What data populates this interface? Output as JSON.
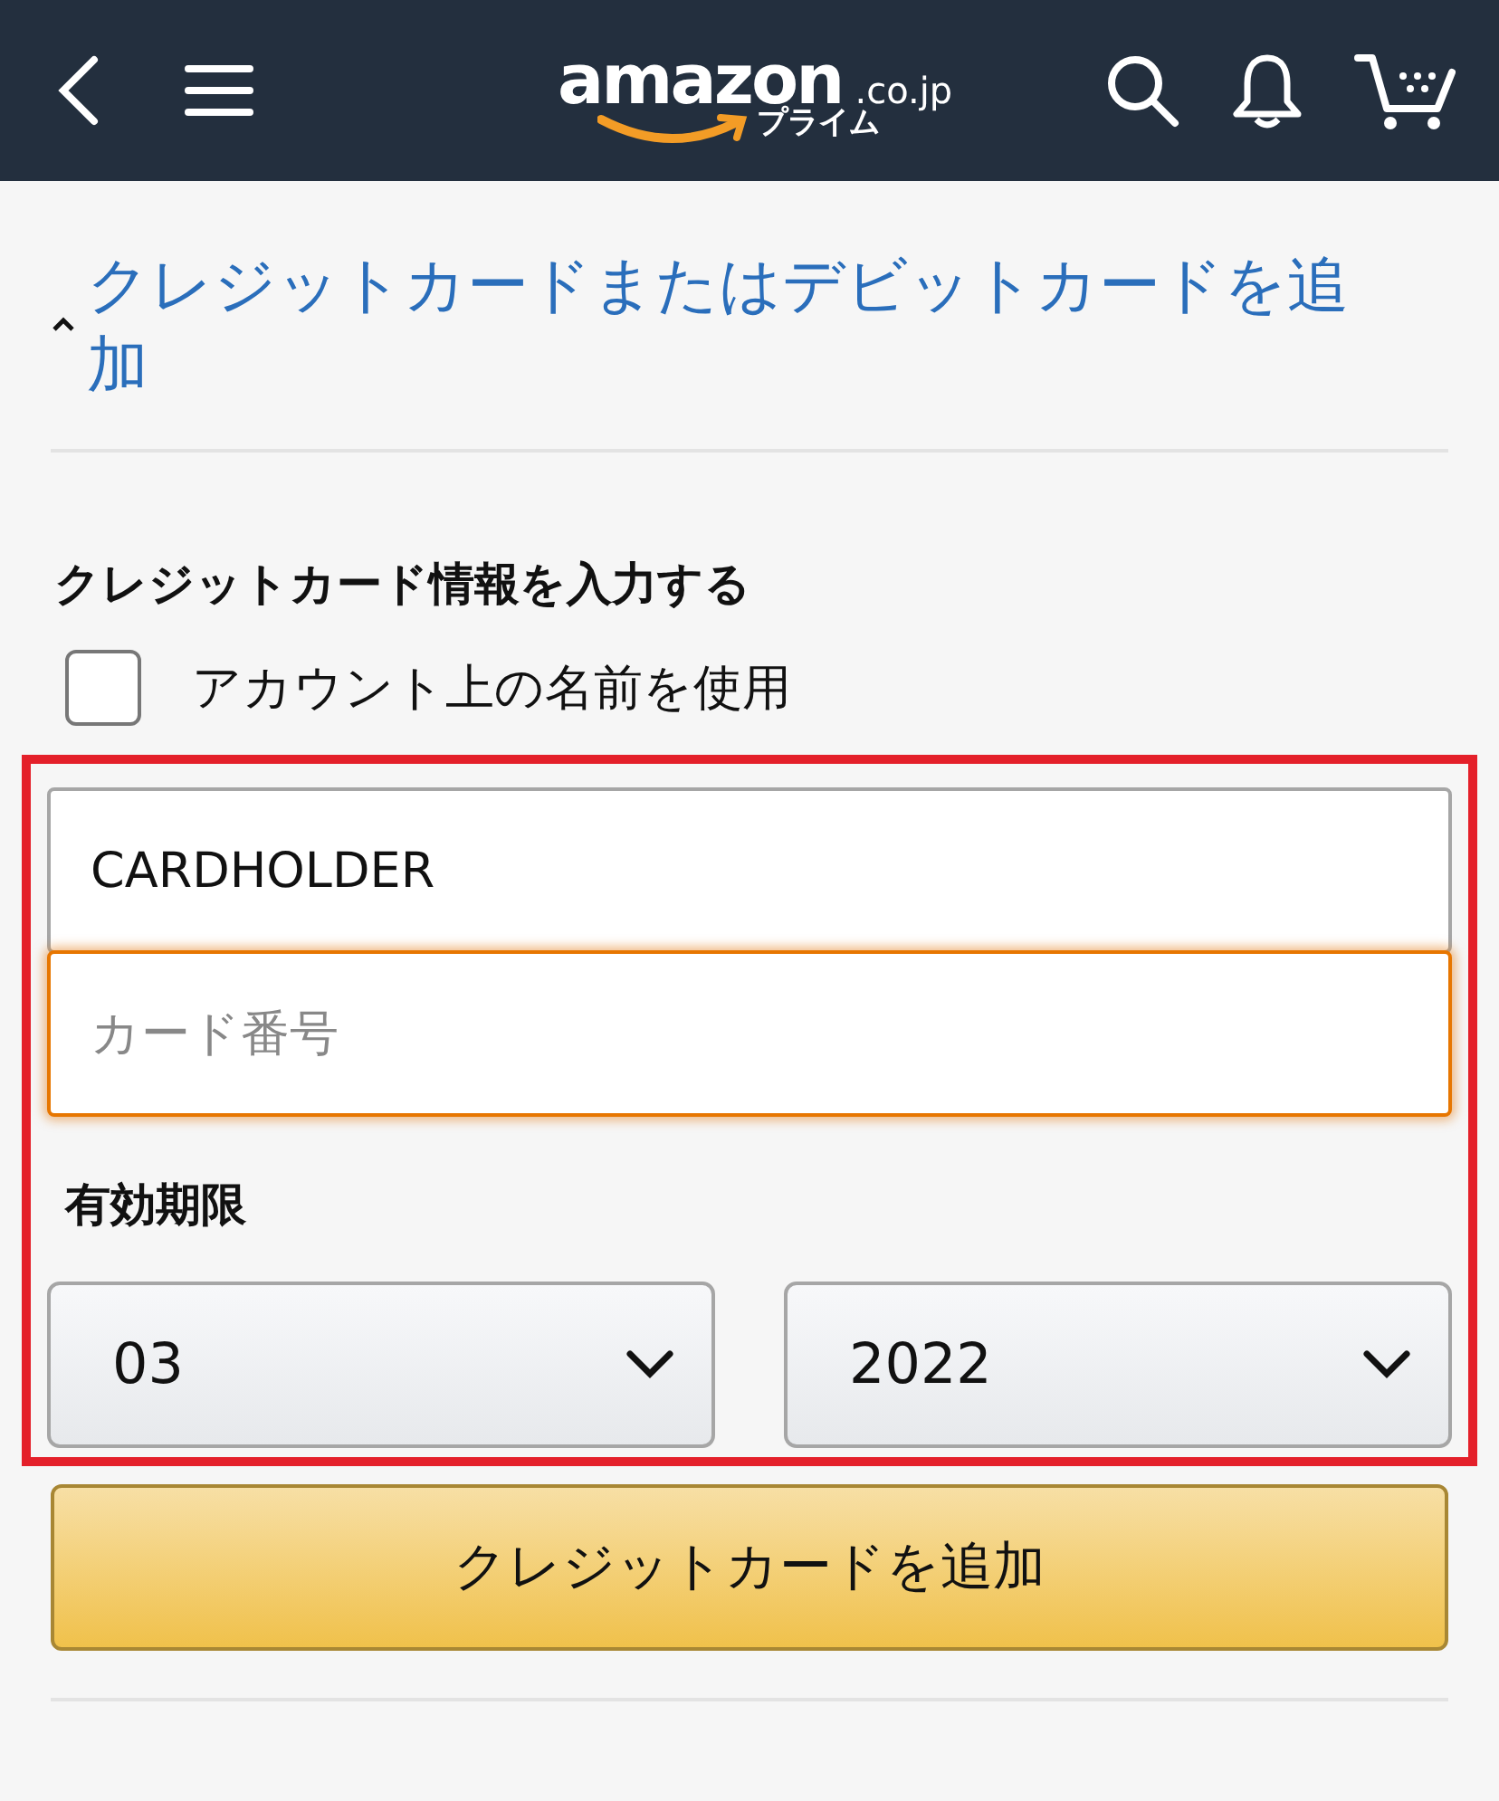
{
  "header": {
    "logo": {
      "wordmark": "amazon",
      "domain": ".co.jp",
      "tagline": "プライム"
    }
  },
  "section": {
    "title": "クレジットカードまたはデビットカードを追加",
    "expanded": true
  },
  "form": {
    "heading": "クレジットカード情報を入力する",
    "use_account_name": {
      "label": "アカウント上の名前を使用",
      "checked": false
    },
    "highlighted": true,
    "fields": [
      {
        "value": "CARDHOLDER",
        "focused": false
      },
      {
        "placeholder": "カード番号",
        "focused": true
      }
    ],
    "expiry_label": "有効期限",
    "selects": [
      {
        "value": "03"
      },
      {
        "value": "2022"
      }
    ],
    "submit": "クレジットカードを追加"
  }
}
